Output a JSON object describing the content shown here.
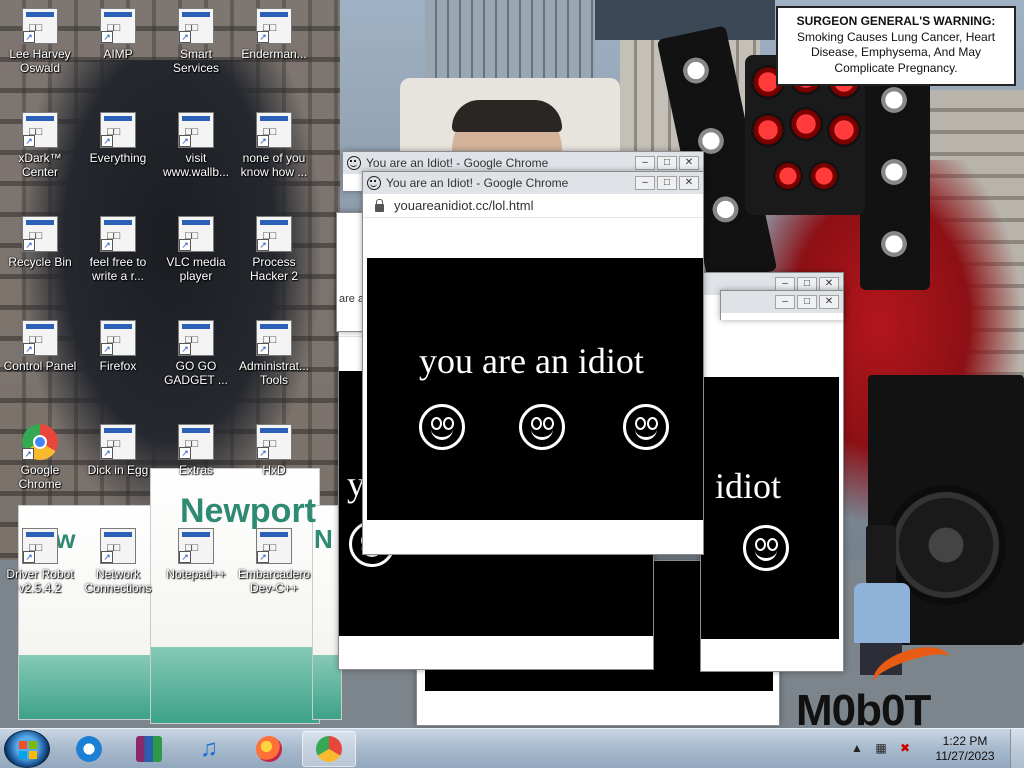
{
  "warning": {
    "heading": "SURGEON GENERAL'S WARNING:",
    "body": "Smoking Causes Lung Cancer, Heart Disease, Emphysema, And May Complicate Pregnancy."
  },
  "wallpaper": {
    "brand_a": "Newport",
    "brand_b": "New",
    "brand_c": "N",
    "logo": "M0b0T"
  },
  "desktop_icons": [
    {
      "label": "Lee Harvey Oswald",
      "icon": "anime-girl-icon"
    },
    {
      "label": "AIMP",
      "icon": "aimp-icon"
    },
    {
      "label": "Smart Services",
      "icon": "smart-services-icon"
    },
    {
      "label": "Enderman...",
      "icon": "enderman-icon"
    },
    {
      "label": "xDark™ Center",
      "icon": "xdark-icon"
    },
    {
      "label": "Everything",
      "icon": "everything-icon"
    },
    {
      "label": "visit www.wallb...",
      "icon": "document-icon"
    },
    {
      "label": "none of you know how ...",
      "icon": "none-of-you-icon"
    },
    {
      "label": "Recycle Bin",
      "icon": "recycle-bin-icon"
    },
    {
      "label": "feel free to write a r...",
      "icon": "text-file-icon"
    },
    {
      "label": "VLC media player",
      "icon": "vlc-icon"
    },
    {
      "label": "Process Hacker 2",
      "icon": "process-hacker-icon"
    },
    {
      "label": "Control Panel",
      "icon": "control-panel-icon"
    },
    {
      "label": "Firefox",
      "icon": "firefox-icon"
    },
    {
      "label": "GO GO GADGET ...",
      "icon": "gadget-icon"
    },
    {
      "label": "Administrat... Tools",
      "icon": "admin-tools-icon"
    },
    {
      "label": "Google Chrome",
      "icon": "chrome-icon"
    },
    {
      "label": "Dick in Egg",
      "icon": "dick-in-egg-icon"
    },
    {
      "label": "Extras",
      "icon": "extras-icon"
    },
    {
      "label": "HxD",
      "icon": "hxd-icon"
    },
    {
      "label": "Driver Robot v2.5.4.2",
      "icon": "driver-robot-icon"
    },
    {
      "label": "Network Connections",
      "icon": "network-icon"
    },
    {
      "label": "Notepad++",
      "icon": "notepadpp-icon"
    },
    {
      "label": "Embarcadero Dev-C++",
      "icon": "devcpp-icon"
    }
  ],
  "windows": {
    "title": "You are an Idiot! - Google Chrome",
    "url": "youareanidiot.cc/lol.html",
    "message": "you are an idiot",
    "message_partial": "idiot",
    "message_fragment": "y",
    "tab_fragment_a": "are a",
    "tab_fragment_b": "ouar",
    "minimize": "–",
    "maximize": "□",
    "close": "✕"
  },
  "taskbar": {
    "buttons": [
      {
        "name": "internet-explorer",
        "icon": "ie-icon"
      },
      {
        "name": "winrar",
        "icon": "winrar-icon"
      },
      {
        "name": "itunes",
        "icon": "itunes-icon"
      },
      {
        "name": "firefox",
        "icon": "firefox-icon"
      },
      {
        "name": "chrome",
        "icon": "chrome-icon",
        "active": true
      }
    ],
    "time": "1:22 PM",
    "date": "11/27/2023"
  },
  "colors": {
    "chrome_red": "#e8453c",
    "chrome_yellow": "#f9bb2d",
    "chrome_green": "#34a853",
    "chrome_blue": "#4285f4",
    "page_black": "#000000"
  }
}
